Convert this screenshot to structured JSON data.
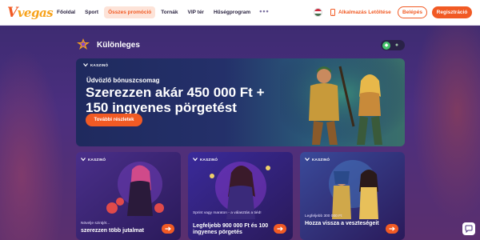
{
  "header": {
    "logo": {
      "v": "V",
      "rest": "vegas"
    },
    "nav": [
      "Főoldal",
      "Sport",
      "Összes promóció",
      "Tornák",
      "VIP tér",
      "Hűségprogram"
    ],
    "more": "•••",
    "app_download": "Alkalmazás Letöltése",
    "login": "Belépés",
    "register": "Regisztráció",
    "flag_icon": "hungary-flag-icon",
    "accent": "#f15a24"
  },
  "section": {
    "title": "Különleges"
  },
  "hero": {
    "badge": "KASZINÓ",
    "subtitle": "Üdvözlő bónuszcsomag",
    "title_line1": "Szerezzen akár 450 000 Ft +",
    "title_line2": "150 ingyenes pörgetést",
    "button": "További részletek"
  },
  "cards": [
    {
      "badge": "KASZINÓ",
      "meta": "Növelje szintjét...",
      "title": "szerezzen több jutalmat"
    },
    {
      "badge": "KASZINÓ",
      "meta": "Sprint vagy maraton - a választás a tiéd!",
      "title": "Legfeljebb 900 000 Ft és 100 ingyenes pörgetés"
    },
    {
      "badge": "KASZINÓ",
      "meta": "Legfeljebb 300 000 Ft",
      "title": "Hozza vissza a veszteségeit"
    }
  ]
}
